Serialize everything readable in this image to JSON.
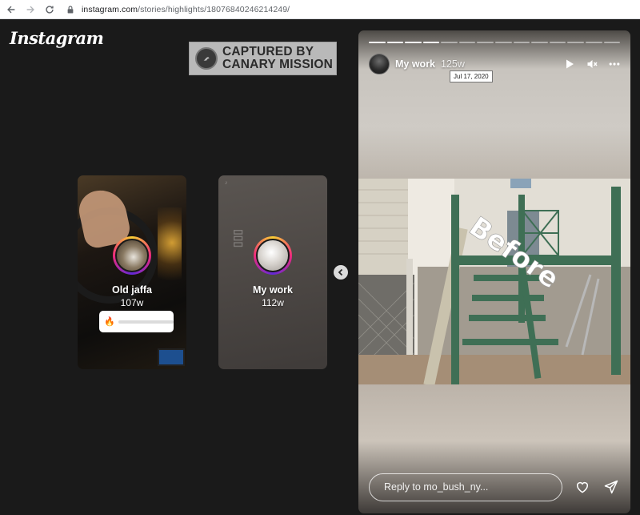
{
  "browser": {
    "url_host": "instagram.com",
    "url_path": "/stories/highlights/18076840246214249/",
    "back_icon": "arrow-left-icon",
    "forward_icon": "arrow-right-icon",
    "reload_icon": "reload-icon",
    "lock_icon": "lock-icon"
  },
  "header": {
    "logo_text": "Instagram"
  },
  "watermark": {
    "line1": "CAPTURED BY",
    "line2": "CANARY MISSION"
  },
  "highlights": [
    {
      "title": "Old jaffa",
      "age": "107w",
      "slider_emoji": "🔥",
      "slider_level": 0
    },
    {
      "title": "My work",
      "age": "112w"
    }
  ],
  "story": {
    "progress": {
      "total": 14,
      "completed": 4
    },
    "username": "My work",
    "age": "125w",
    "tooltip": "Jul 17, 2020",
    "play_icon": "play-icon",
    "mute_icon": "mute-icon",
    "more_icon": "more-icon",
    "photo_caption": "Before",
    "reply_placeholder": "Reply to mo_bush_ny...",
    "like_icon": "heart-icon",
    "share_icon": "send-icon"
  },
  "colors": {
    "background": "#1a1a1a",
    "stairs_green": "#3f6f55",
    "ring_gradient": [
      "#f9ce34",
      "#ee2a7b",
      "#6228d7"
    ]
  }
}
